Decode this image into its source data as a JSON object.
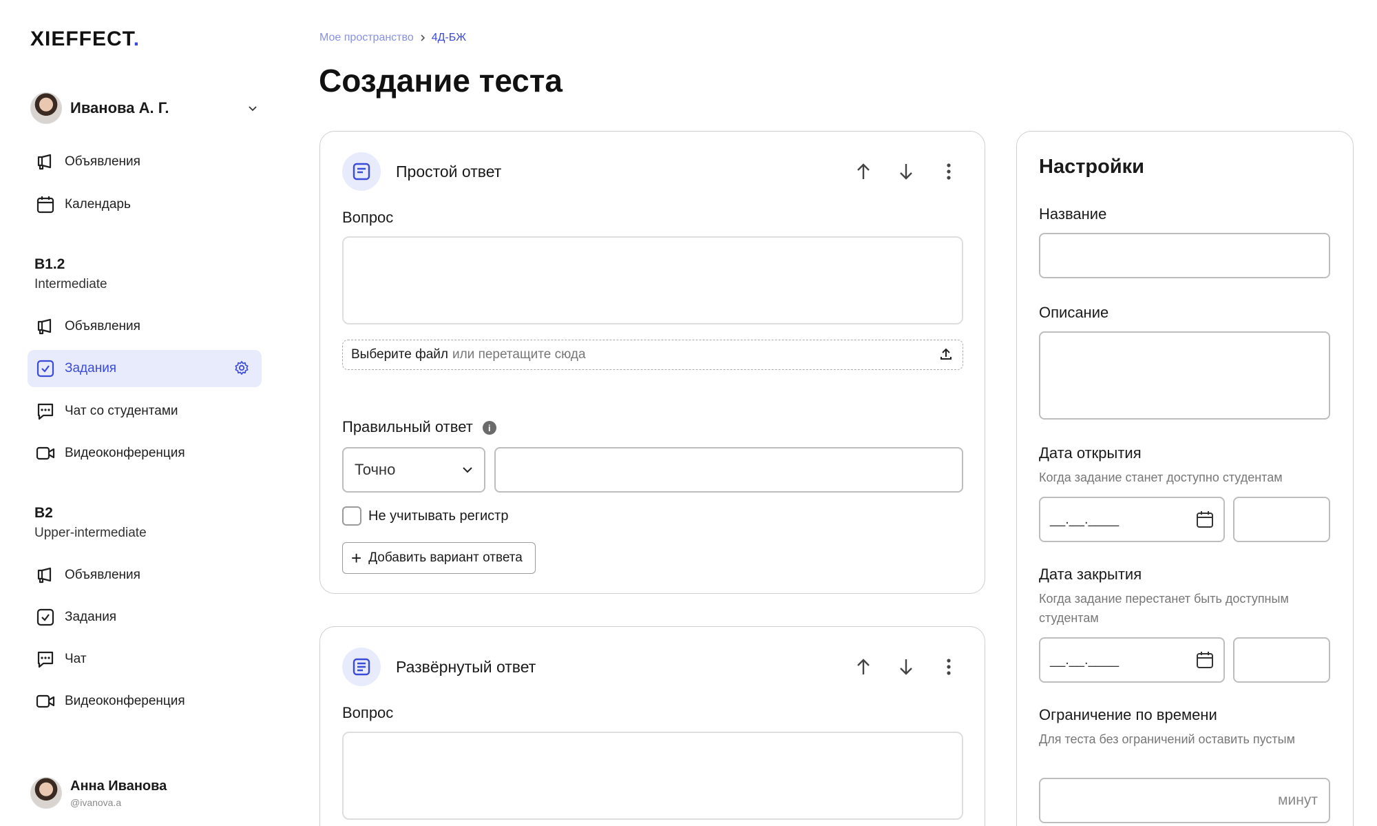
{
  "brand": {
    "logo_text": "XIEFFECT",
    "logo_dot": ".",
    "accent": "#3a4bd9"
  },
  "profile": {
    "name": "Иванова А. Г."
  },
  "nav_top": [
    {
      "label": "Объявления",
      "icon": "megaphone-icon"
    },
    {
      "label": "Календарь",
      "icon": "calendar-icon"
    }
  ],
  "groups": [
    {
      "title": "B1.2",
      "subtitle": "Intermediate",
      "items": [
        {
          "label": "Объявления",
          "icon": "megaphone-icon"
        },
        {
          "label": "Задания",
          "icon": "task-icon",
          "active": true
        },
        {
          "label": "Чат со студентами",
          "icon": "chat-icon"
        },
        {
          "label": "Видеоконференция",
          "icon": "video-icon"
        }
      ]
    },
    {
      "title": "B2",
      "subtitle": "Upper-intermediate",
      "items": [
        {
          "label": "Объявления",
          "icon": "megaphone-icon"
        },
        {
          "label": "Задания",
          "icon": "task-icon"
        },
        {
          "label": "Чат",
          "icon": "chat-icon"
        },
        {
          "label": "Видеоконференция",
          "icon": "video-icon"
        }
      ]
    }
  ],
  "user": {
    "name": "Анна Иванова",
    "handle": "@ivanova.a"
  },
  "breadcrumb": {
    "root": "Мое пространство",
    "current": "4Д-БЖ"
  },
  "page_title": "Создание теста",
  "question_cards": [
    {
      "title": "Простой ответ",
      "question_label": "Вопрос",
      "file_choose": "Выберите файл",
      "file_drop": "или перетащите сюда",
      "correct_label": "Правильный ответ",
      "match_mode": "Точно",
      "ignore_case_label": "Не учитывать регистр",
      "add_variant_label": "Добавить вариант ответа"
    },
    {
      "title": "Развёрнутый ответ",
      "question_label": "Вопрос"
    }
  ],
  "settings": {
    "title": "Настройки",
    "name_label": "Название",
    "description_label": "Описание",
    "open_label": "Дата открытия",
    "open_hint": "Когда задание станет доступно студентам",
    "close_label": "Дата закрытия",
    "close_hint": "Когда задание перестанет быть доступным студентам",
    "date_placeholder": "__.__.____",
    "time_limit_label": "Ограничение по времени",
    "time_limit_hint": "Для теста без ограничений оставить пустым",
    "time_unit": "минут"
  }
}
